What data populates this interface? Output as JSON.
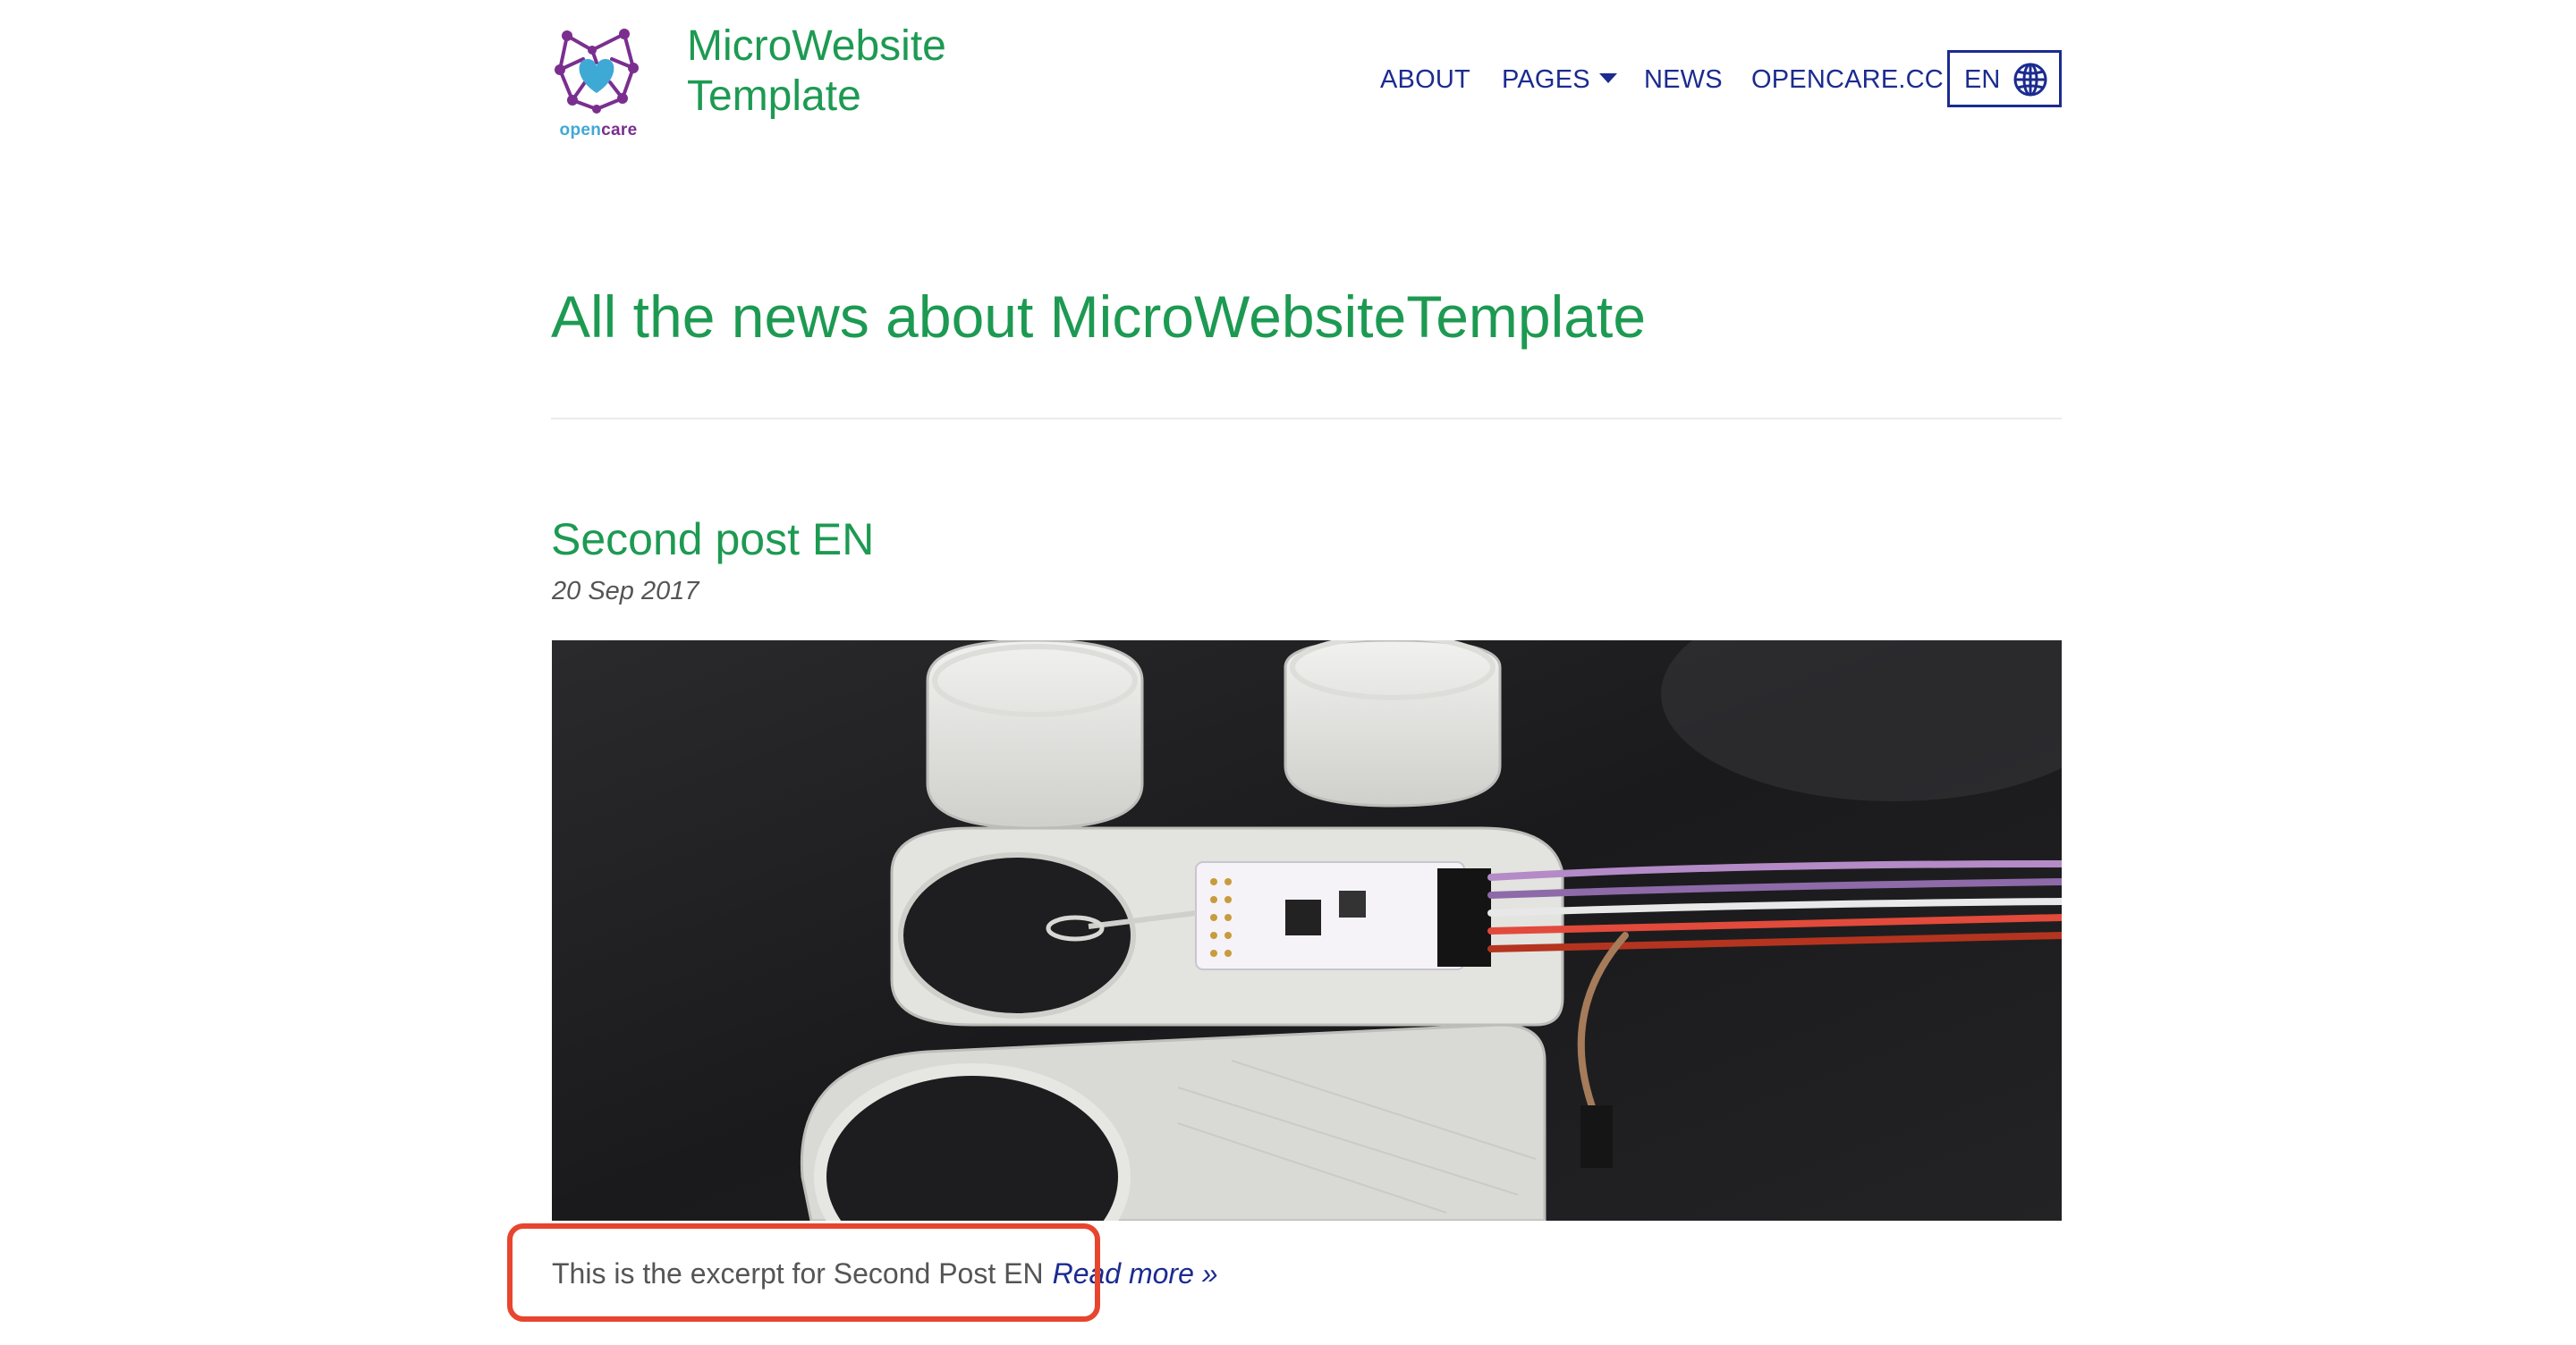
{
  "header": {
    "logo": {
      "icon": "opencare-network-heart-icon",
      "word_part1": "open",
      "word_part2": "care"
    },
    "site_title_line1": "MicroWebsite",
    "site_title_line2": "Template"
  },
  "nav": {
    "items": [
      {
        "label": "ABOUT"
      },
      {
        "label": "PAGES",
        "has_dropdown": true,
        "icon": "caret-down-icon"
      },
      {
        "label": "NEWS"
      },
      {
        "label": "OPENCARE.CC"
      }
    ],
    "language": {
      "label": "EN",
      "icon": "globe-icon"
    }
  },
  "main": {
    "heading": "All the news about MicroWebsiteTemplate",
    "post": {
      "title": "Second post EN",
      "date": "20 Sep 2017",
      "image_alt": "3D-printed wearable rings and base with sensor circuit board and colored wires",
      "excerpt": "This is the excerpt for Second Post EN",
      "read_more": "Read more »"
    }
  },
  "colors": {
    "brand_green": "#1d9a52",
    "nav_blue": "#1b2b8f",
    "text_gray": "#555555",
    "highlight_red": "#e8452e",
    "logo_purple": "#7a2f8f",
    "logo_blue": "#3fa9d6"
  }
}
